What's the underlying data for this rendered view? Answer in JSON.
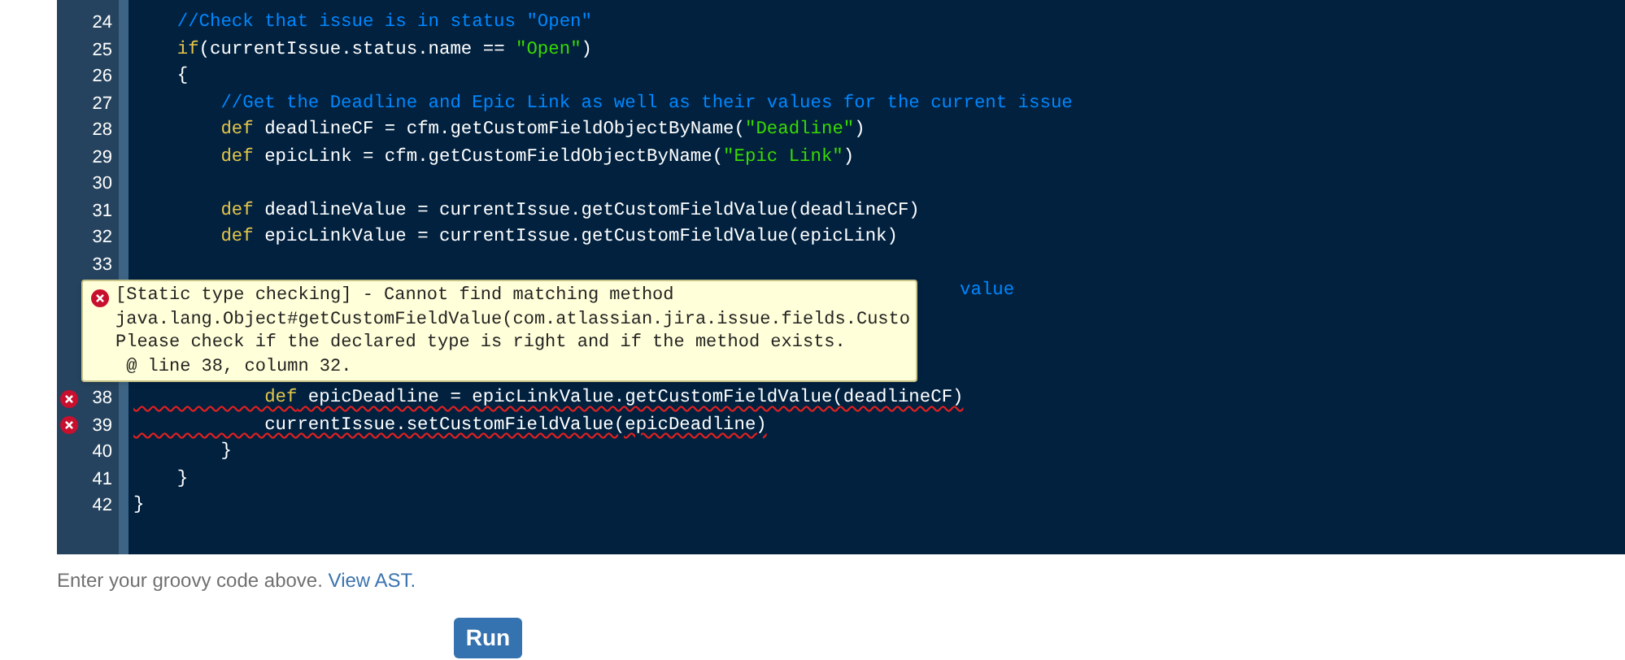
{
  "editor": {
    "lines": [
      {
        "number": "24",
        "error": false,
        "tokens": [
          {
            "kind": "comment",
            "text": "    //Check that issue is in status \"Open\""
          }
        ]
      },
      {
        "number": "25",
        "error": false,
        "tokens": [
          {
            "kind": "keyword",
            "text": "    if"
          },
          {
            "kind": "plain",
            "text": "(currentIssue.status.name == "
          },
          {
            "kind": "string",
            "text": "\"Open\""
          },
          {
            "kind": "plain",
            "text": ")"
          }
        ]
      },
      {
        "number": "26",
        "error": false,
        "tokens": [
          {
            "kind": "plain",
            "text": "    {"
          }
        ]
      },
      {
        "number": "27",
        "error": false,
        "tokens": [
          {
            "kind": "comment",
            "text": "        //Get the Deadline and Epic Link as well as their values for the current issue"
          }
        ]
      },
      {
        "number": "28",
        "error": false,
        "tokens": [
          {
            "kind": "keyword",
            "text": "        def"
          },
          {
            "kind": "plain",
            "text": " deadlineCF = cfm.getCustomFieldObjectByName("
          },
          {
            "kind": "string",
            "text": "\"Deadline\""
          },
          {
            "kind": "plain",
            "text": ")"
          }
        ]
      },
      {
        "number": "29",
        "error": false,
        "tokens": [
          {
            "kind": "keyword",
            "text": "        def"
          },
          {
            "kind": "plain",
            "text": " epicLink = cfm.getCustomFieldObjectByName("
          },
          {
            "kind": "string",
            "text": "\"Epic Link\""
          },
          {
            "kind": "plain",
            "text": ")"
          }
        ]
      },
      {
        "number": "30",
        "error": false
      },
      {
        "number": "31",
        "error": false,
        "tokens": [
          {
            "kind": "keyword",
            "text": "        def"
          },
          {
            "kind": "plain",
            "text": " deadlineValue = currentIssue.getCustomFieldValue(deadlineCF)"
          }
        ]
      },
      {
        "number": "32",
        "error": false,
        "tokens": [
          {
            "kind": "keyword",
            "text": "        def"
          },
          {
            "kind": "plain",
            "text": " epicLinkValue = currentIssue.getCustomFieldValue(epicLink)"
          }
        ]
      },
      {
        "number": "33",
        "error": false
      },
      {
        "kind": "partial",
        "tokens": [
          {
            "kind": "comment",
            "text": "value"
          }
        ]
      },
      {
        "number": "38",
        "error": true,
        "tokens": [
          {
            "kind": "keyword",
            "text": "            def"
          },
          {
            "kind": "plain",
            "text": " epicDeadline = epicLinkValue.getCustomFieldValue(deadlineCF)"
          }
        ]
      },
      {
        "number": "39",
        "error": true,
        "tokens": [
          {
            "kind": "plain",
            "text": "            currentIssue.setCustomFieldValue(epicDeadline)"
          }
        ]
      },
      {
        "number": "40",
        "error": false,
        "tokens": [
          {
            "kind": "plain",
            "text": "        }"
          }
        ]
      },
      {
        "number": "41",
        "error": false,
        "tokens": [
          {
            "kind": "plain",
            "text": "    }"
          }
        ]
      },
      {
        "number": "42",
        "error": false,
        "tokens": [
          {
            "kind": "plain",
            "text": "}"
          }
        ]
      }
    ],
    "tooltip": {
      "lines": [
        "[Static type checking] - Cannot find matching method",
        "java.lang.Object#getCustomFieldValue(com.atlassian.jira.issue.fields.Custo",
        "Please check if the declared type is right and if the method exists.",
        " @ line 38, column 32."
      ]
    }
  },
  "hint": {
    "text": "Enter your groovy code above.",
    "link": "View AST."
  },
  "run_button": "Run"
}
